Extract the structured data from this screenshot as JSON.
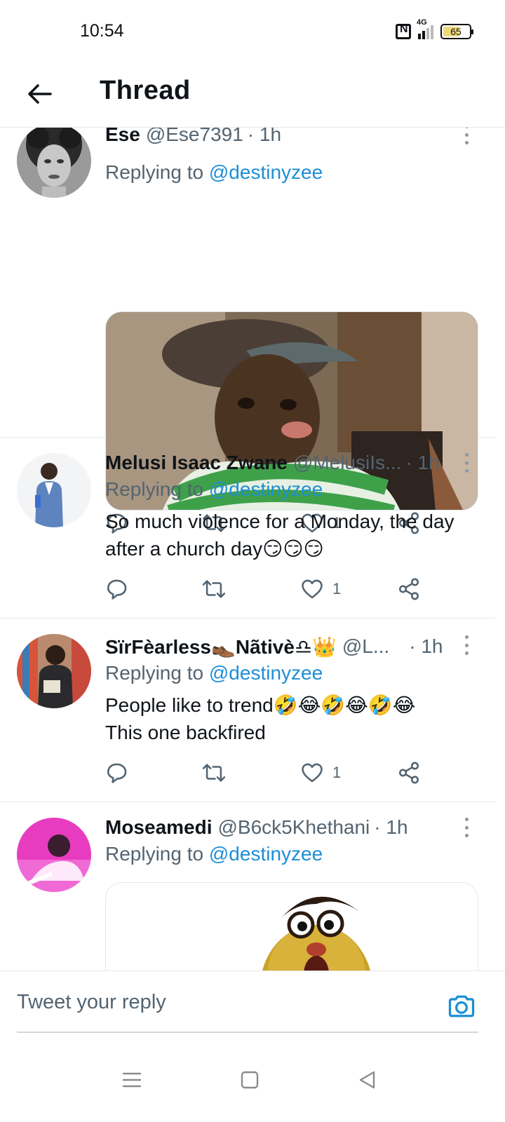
{
  "status_bar": {
    "time": "10:54",
    "network": "4G",
    "battery": "65"
  },
  "header": {
    "title": "Thread"
  },
  "tweets": [
    {
      "name": "Ese",
      "handle": "@Ese7391",
      "time": "· 1h",
      "replying_prefix": "Replying to ",
      "replying_to": "@destinyzee",
      "text": "",
      "media": "kid-in-cap-meme",
      "likes": "1"
    },
    {
      "name": "Melusi Isaac Zwane",
      "handle": "@MelusiIs...",
      "time": "· 1h",
      "replying_prefix": "Replying to ",
      "replying_to": "@destinyzee",
      "text_line1": "So much violence for a Monday, the day",
      "text_line2": "after a church day😏😏😏",
      "likes": "1"
    },
    {
      "name": "SïrFèarless👞Nãtivè♎👑",
      "handle": "@L...",
      "time": "· 1h",
      "replying_prefix": "Replying to ",
      "replying_to": "@destinyzee",
      "text_line1": "People like to trend🤣😂🤣😂🤣😂",
      "text_line2": "This one backfired",
      "likes": "1"
    },
    {
      "name": "Moseamedi",
      "handle": "@B6ck5Khethani",
      "time": "· 1h",
      "replying_prefix": "Replying to ",
      "replying_to": "@destinyzee",
      "media": "puppet-meme"
    }
  ],
  "reply_bar": {
    "placeholder": "Tweet your reply"
  },
  "icons": {
    "accent": "#1d8fd6",
    "reply": "reply-icon",
    "retweet": "retweet-icon",
    "like": "heart-icon",
    "share": "share-icon",
    "camera": "camera-icon",
    "back": "back-arrow-icon"
  }
}
